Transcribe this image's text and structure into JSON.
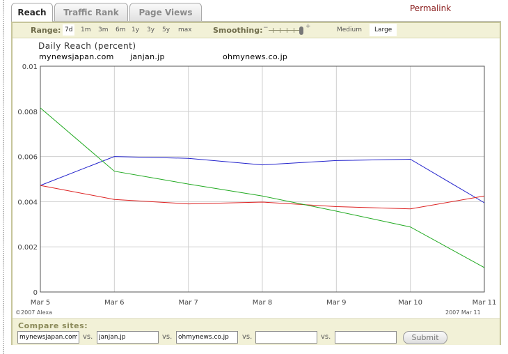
{
  "tabs": [
    {
      "label": "Reach",
      "active": true
    },
    {
      "label": "Traffic Rank",
      "active": false
    },
    {
      "label": "Page Views",
      "active": false
    }
  ],
  "permalink": "Permalink",
  "controls": {
    "range_label": "Range:",
    "range_options": [
      "7d",
      "1m",
      "3m",
      "6m",
      "1y",
      "3y",
      "5y",
      "max"
    ],
    "range_selected": "7d",
    "smoothing_label": "Smoothing:",
    "smoothing_min": "−",
    "smoothing_plus": "+",
    "size_options": [
      "Medium",
      "Large"
    ],
    "size_selected": "Large"
  },
  "chart_data": {
    "type": "line",
    "title": "Daily Reach (percent)",
    "categories": [
      "Mar 5",
      "Mar 6",
      "Mar 7",
      "Mar 8",
      "Mar 9",
      "Mar 10",
      "Mar 11"
    ],
    "y_ticks": [
      "0.01",
      "0.008",
      "0.006",
      "0.004",
      "0.002",
      "0"
    ],
    "ylim": [
      0,
      0.01
    ],
    "grid": true,
    "series": [
      {
        "name": "mynewsjapan.com",
        "color": "#2222cc",
        "values": [
          0.00472,
          0.006,
          0.00592,
          0.00563,
          0.00582,
          0.00588,
          0.00395
        ]
      },
      {
        "name": "janjan.jp",
        "color": "#dd2222",
        "values": [
          0.00472,
          0.0041,
          0.0039,
          0.00398,
          0.00378,
          0.00368,
          0.00425
        ]
      },
      {
        "name": "ohmynews.co.jp",
        "color": "#22aa22",
        "values": [
          0.00815,
          0.00535,
          0.00478,
          0.00425,
          0.00358,
          0.00288,
          0.00108
        ]
      }
    ]
  },
  "copyright": "©2007 Alexa",
  "date_stamp": "2007 Mar 11",
  "compare": {
    "label": "Compare sites:",
    "sites": [
      "mynewsjapan.com",
      "janjan.jp",
      "ohmynews.co.jp",
      "",
      ""
    ],
    "vs_label": "vs.",
    "submit_label": "Submit"
  }
}
